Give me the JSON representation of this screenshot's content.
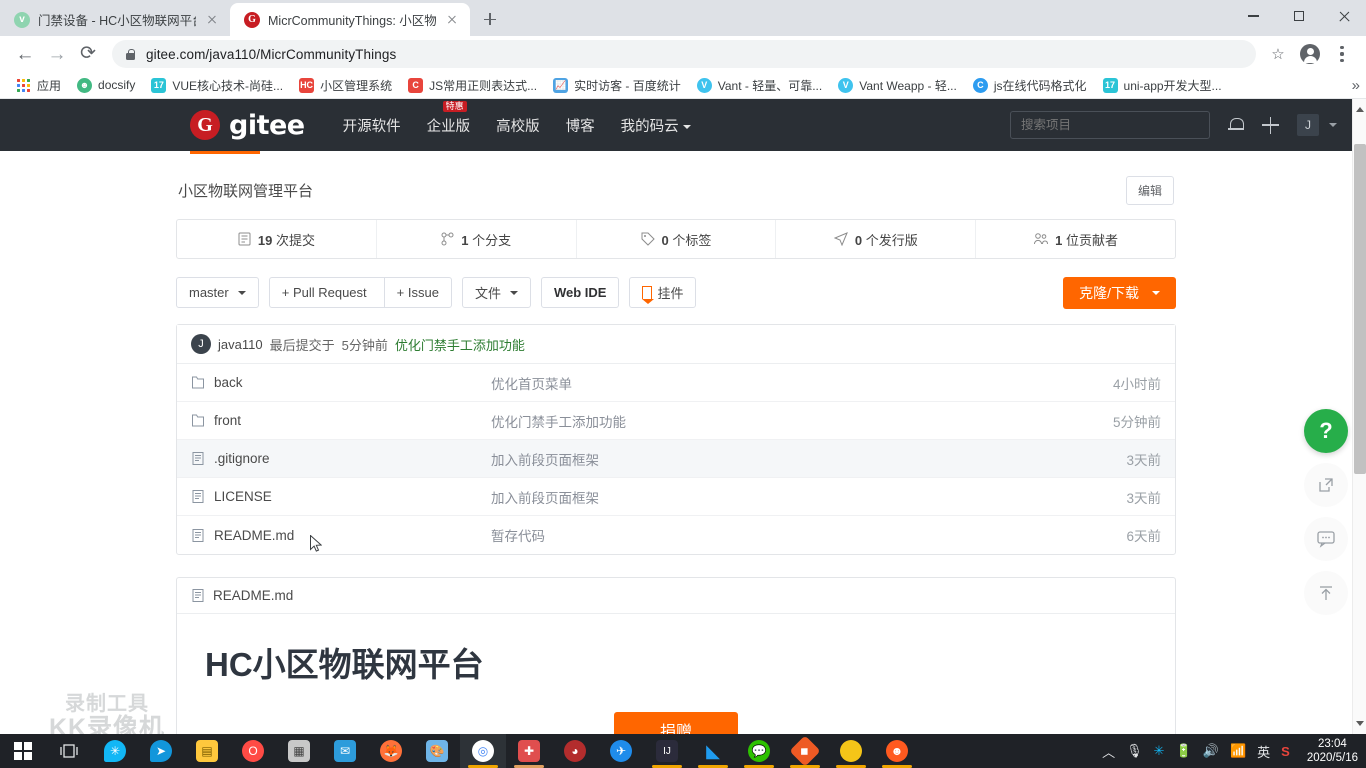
{
  "browser": {
    "tabs": [
      {
        "title": "门禁设备 - HC小区物联网平台",
        "active": false
      },
      {
        "title": "MicrCommunityThings: 小区物",
        "active": true
      }
    ],
    "url": "gitee.com/java110/MicrCommunityThings",
    "bookmarks": [
      {
        "label": "应用",
        "icon": "apps-grid-icon"
      },
      {
        "label": "docsify",
        "icon": "docsify-icon"
      },
      {
        "label": "VUE核心技术-尚硅...",
        "icon": "calendar-icon"
      },
      {
        "label": "小区管理系统",
        "icon": "hc-icon"
      },
      {
        "label": "JS常用正则表达式...",
        "icon": "c-icon"
      },
      {
        "label": "实时访客 - 百度统计",
        "icon": "chart-icon"
      },
      {
        "label": "Vant - 轻量、可靠...",
        "icon": "vant-icon"
      },
      {
        "label": "Vant Weapp - 轻...",
        "icon": "vant-icon"
      },
      {
        "label": "js在线代码格式化",
        "icon": "c-circle-icon"
      },
      {
        "label": "uni-app开发大型...",
        "icon": "calendar-icon"
      }
    ],
    "bookmark_overflow": "»",
    "window_controls": {
      "minimize": "—",
      "maximize": "▢",
      "close": "✕"
    }
  },
  "gitee": {
    "brand": "gitee",
    "logo_letter": "G",
    "nav": [
      {
        "label": "开源软件",
        "badge": ""
      },
      {
        "label": "企业版",
        "badge": "特惠"
      },
      {
        "label": "高校版",
        "badge": ""
      },
      {
        "label": "博客",
        "badge": ""
      },
      {
        "label": "我的码云",
        "badge": "",
        "caret": true
      }
    ],
    "search_placeholder": "搜索项目",
    "user_initial": "J",
    "accent_color": "#f60",
    "header_bg": "#2a2f35"
  },
  "repo": {
    "description": "小区物联网管理平台",
    "edit_label": "编辑",
    "stats": [
      {
        "icon": "commit-icon",
        "count": "19",
        "label": "次提交"
      },
      {
        "icon": "branch-icon",
        "count": "1",
        "label": "个分支"
      },
      {
        "icon": "tag-icon",
        "count": "0",
        "label": "个标签"
      },
      {
        "icon": "release-icon",
        "count": "0",
        "label": "个发行版"
      },
      {
        "icon": "contributor-icon",
        "count": "1",
        "label": "位贡献者"
      }
    ],
    "actions": {
      "branch": "master",
      "pull_request": "+ Pull Request",
      "issue": "+ Issue",
      "files": "文件",
      "web_ide": "Web IDE",
      "widget": "挂件",
      "clone": "克隆/下载"
    },
    "commit": {
      "avatar_letter": "J",
      "author": "java110",
      "action": "最后提交于",
      "time": "5分钟前",
      "message": "优化门禁手工添加功能"
    },
    "files": [
      {
        "name": "back",
        "type": "folder",
        "message": "优化首页菜单",
        "time": "4小时前",
        "hover": false
      },
      {
        "name": "front",
        "type": "folder",
        "message": "优化门禁手工添加功能",
        "time": "5分钟前",
        "hover": false
      },
      {
        "name": ".gitignore",
        "type": "file",
        "message": "加入前段页面框架",
        "time": "3天前",
        "hover": true
      },
      {
        "name": "LICENSE",
        "type": "file",
        "message": "加入前段页面框架",
        "time": "3天前",
        "hover": false
      },
      {
        "name": "README.md",
        "type": "file",
        "message": "暂存代码",
        "time": "6天前",
        "hover": false
      }
    ],
    "readme": {
      "filename": "README.md",
      "heading": "HC小区物联网平台",
      "donate_label": "捐赠"
    }
  },
  "rail": [
    {
      "name": "help",
      "glyph": "?"
    },
    {
      "name": "share",
      "glyph": "↗"
    },
    {
      "name": "feedback",
      "glyph": "…"
    },
    {
      "name": "back-to-top",
      "glyph": "↑"
    }
  ],
  "watermark": {
    "line1": "录制工具",
    "line2": "KK录像机"
  },
  "taskbar": {
    "items": [
      {
        "name": "start",
        "color": "#0078d7"
      },
      {
        "name": "task-view",
        "color": "#ffffff"
      },
      {
        "name": "tim",
        "color": "#12b7f5"
      },
      {
        "name": "navigation-app",
        "color": "#1296db"
      },
      {
        "name": "file-explorer",
        "color": "#ffc83d"
      },
      {
        "name": "opera",
        "color": "#ff4b45"
      },
      {
        "name": "editor",
        "color": "#c8c8c8"
      },
      {
        "name": "mail",
        "color": "#2d9cdb"
      },
      {
        "name": "firefox",
        "color": "#ff7139"
      },
      {
        "name": "paint",
        "color": "#6fb5e8"
      },
      {
        "name": "chrome",
        "color": "#4285f4"
      },
      {
        "name": "notepadpp",
        "color": "#e04e4e"
      },
      {
        "name": "picpick",
        "color": "#b32d2d"
      },
      {
        "name": "foxmail",
        "color": "#1f8ceb"
      },
      {
        "name": "idea",
        "color": "#fe315d"
      },
      {
        "name": "vscode",
        "color": "#1f9cf0"
      },
      {
        "name": "wechat",
        "color": "#2dc100"
      },
      {
        "name": "xmind",
        "color": "#ee5a24"
      },
      {
        "name": "crab-app",
        "color": "#f5c518"
      },
      {
        "name": "kk-recorder",
        "color": "#ff5a1f"
      }
    ],
    "tray": {
      "overflow": "︿",
      "mic": "mic-icon",
      "tim": "tim-icon",
      "battery": "battery-icon",
      "volume": "volume-icon",
      "wifi": "wifi-icon",
      "ime": "英",
      "sogou": "S",
      "time": "23:04",
      "date": "2020/5/16"
    }
  }
}
